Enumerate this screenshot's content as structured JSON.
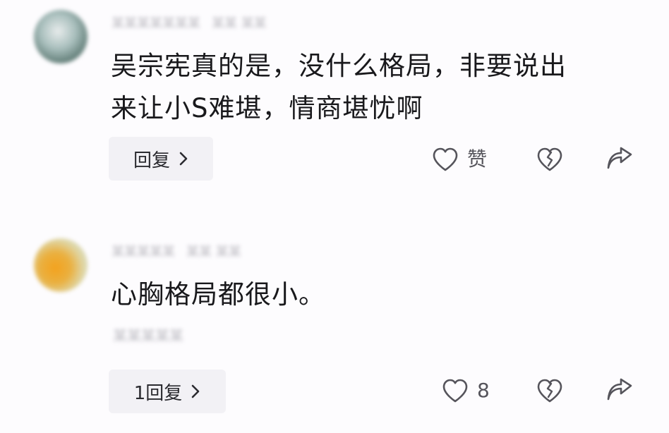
{
  "comments": [
    {
      "username": "某某某某某某某",
      "meta": "某某 某某",
      "text_line1": "吴宗宪真的是，没什么格局，非要说出",
      "text_line2": "来让小S难堪，情商堪忧啊",
      "translate": "",
      "reply_label": "回复",
      "like_label": "赞"
    },
    {
      "username": "某某某某某",
      "meta": "某某 某某",
      "text_line1": "心胸格局都很小。",
      "text_line2": "",
      "translate": "某某某某某",
      "reply_label": "1回复",
      "like_label": "8"
    }
  ],
  "icons": {
    "like": "heart-outline-icon",
    "dislike": "broken-heart-icon",
    "share": "share-arrow-icon",
    "reply_chevron": "chevron-right-icon"
  },
  "colors": {
    "background": "#fdfcfe",
    "text": "#19191c",
    "reply_button_bg": "#f2f1f5",
    "icon": "#55545b"
  }
}
